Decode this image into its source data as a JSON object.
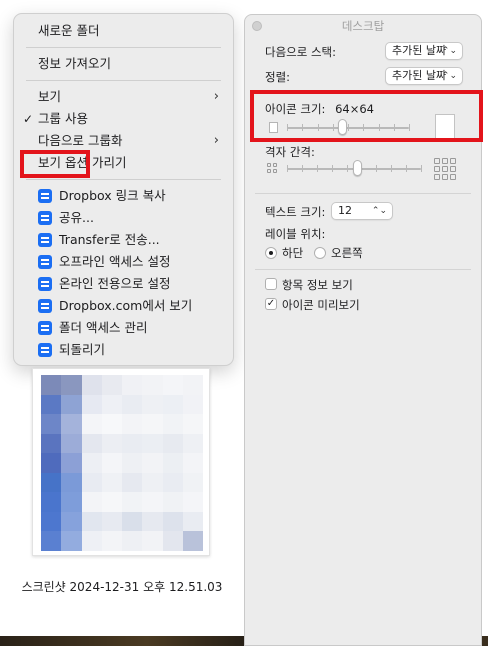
{
  "context_menu": {
    "items": [
      {
        "label": "새로운 폴더"
      },
      {
        "label": "정보 가져오기"
      },
      {
        "label": "보기",
        "submenu": true
      },
      {
        "label": "그룹 사용",
        "checked": true
      },
      {
        "label": "다음으로 그룹화",
        "submenu": true
      },
      {
        "label": "보기 옵션 가리기"
      }
    ],
    "dropbox_items": [
      {
        "label": "Dropbox 링크 복사"
      },
      {
        "label": "공유..."
      },
      {
        "label": "Transfer로 전송..."
      },
      {
        "label": "오프라인 액세스 설정"
      },
      {
        "label": "온라인 전용으로 설정"
      },
      {
        "label": "Dropbox.com에서 보기"
      },
      {
        "label": "폴더 액세스 관리"
      },
      {
        "label": "되돌리기"
      }
    ],
    "icons": {
      "submenu": "chevron-right-icon",
      "check": "checkmark-icon",
      "dropbox": "dropbox-icon"
    }
  },
  "file": {
    "name": "스크린샷 2024-12-31 오후 12.51.03"
  },
  "panel": {
    "title": "데스크탑",
    "stack_by_label": "다음으로 스택:",
    "stack_by_value": "추가된 날짜",
    "sort_label": "정렬:",
    "sort_value": "추가된 날짜",
    "icon_size_label": "아이콘 크기:",
    "icon_size_value": "64×64",
    "icon_size_level": 0.45,
    "grid_spacing_label": "격자 간격:",
    "grid_spacing_level": 0.52,
    "text_size_label": "텍스트 크기:",
    "text_size_value": "12",
    "label_position_label": "레이블 위치:",
    "label_position_options": [
      "하단",
      "오른쪽"
    ],
    "label_position_selected": "하단",
    "show_item_info_label": "항목 정보 보기",
    "show_item_info_checked": false,
    "show_icon_preview_label": "아이콘 미리보기",
    "show_icon_preview_checked": true
  },
  "highlight_color": "#e3141b",
  "accent": "#1b6ef3"
}
